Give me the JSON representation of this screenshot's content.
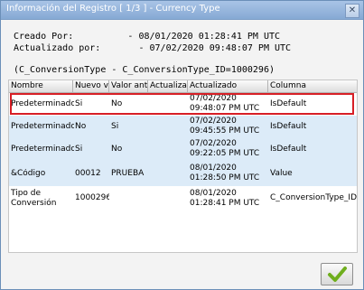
{
  "window": {
    "title": "Información del Registro [ 1/3 ] - Currency Type"
  },
  "info": {
    "created_line": "Creado Por:          - 08/01/2020 01:28:41 PM UTC",
    "updated_line": "Actualizado por:       - 07/02/2020 09:48:07 PM UTC",
    "table_line": "(C_ConversionType - C_ConversionType_ID=1000296)"
  },
  "table": {
    "headers": [
      "Nombre",
      "Nuevo v",
      "Valor ante",
      "Actualizad",
      "Actualizado",
      "Columna"
    ],
    "rows": [
      [
        "Predeterminado",
        "Si",
        "No",
        "",
        "07/02/2020\n09:48:07 PM UTC",
        "IsDefault"
      ],
      [
        "Predeterminado",
        "No",
        "Si",
        "",
        "07/02/2020\n09:45:55 PM UTC",
        "IsDefault"
      ],
      [
        "Predeterminado",
        "Si",
        "No",
        "",
        "07/02/2020\n09:22:05 PM UTC",
        "IsDefault"
      ],
      [
        "&Código",
        "00012",
        "PRUEBA",
        "",
        "08/01/2020\n01:28:50 PM UTC",
        "Value"
      ],
      [
        "Tipo de\nConversión",
        "1000296",
        "",
        "",
        "08/01/2020\n01:28:41 PM UTC",
        "C_ConversionType_ID"
      ]
    ]
  },
  "icons": {
    "close": "close-icon",
    "ok": "checkmark-icon"
  },
  "colors": {
    "selection_border": "#d71f26",
    "row_alt": "#dcebf8",
    "checkmark": "#6fae1d"
  }
}
